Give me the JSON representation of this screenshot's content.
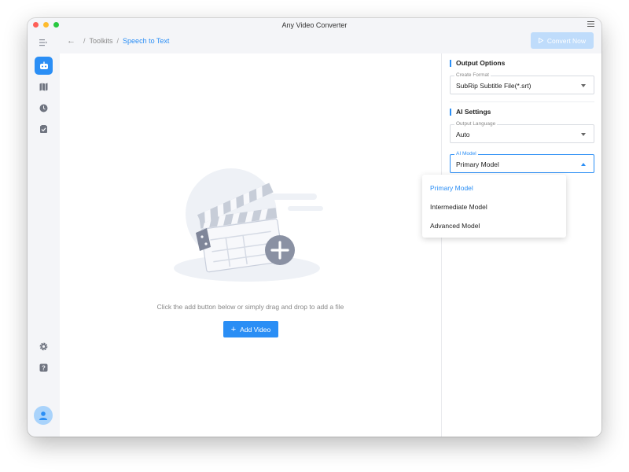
{
  "window": {
    "title": "Any Video Converter"
  },
  "breadcrumb": {
    "items": [
      "Toolkits",
      "Speech to Text"
    ],
    "separator": "/"
  },
  "toolbar": {
    "convert_label": "Convert Now"
  },
  "sidebar": {
    "items": [
      {
        "name": "toolkit",
        "icon": "robot-icon",
        "active": true
      },
      {
        "name": "map",
        "icon": "map-icon",
        "active": false
      },
      {
        "name": "history",
        "icon": "clock-icon",
        "active": false
      },
      {
        "name": "tasks",
        "icon": "checklist-icon",
        "active": false
      }
    ],
    "bottom": [
      {
        "name": "settings",
        "icon": "gear-icon"
      },
      {
        "name": "help",
        "icon": "help-icon"
      },
      {
        "name": "account",
        "icon": "avatar-icon"
      }
    ]
  },
  "main": {
    "hint": "Click the add button below or simply drag and drop to add a file",
    "add_label": "Add Video"
  },
  "panel": {
    "output_options": {
      "title": "Output Options",
      "format": {
        "label": "Create Format",
        "value": "SubRip Subtitle File(*.srt)"
      }
    },
    "ai_settings": {
      "title": "AI Settings",
      "language": {
        "label": "Output Language",
        "value": "Auto"
      },
      "model": {
        "label": "AI Model",
        "value": "Primary Model",
        "open": true
      }
    }
  },
  "dropdown": {
    "options": [
      "Primary Model",
      "Intermediate Model",
      "Advanced Model"
    ],
    "selected": "Primary Model"
  },
  "colors": {
    "accent": "#2a8ef5",
    "accent_disabled": "#bfdcfb",
    "sidebar_bg": "#f4f5f8"
  }
}
